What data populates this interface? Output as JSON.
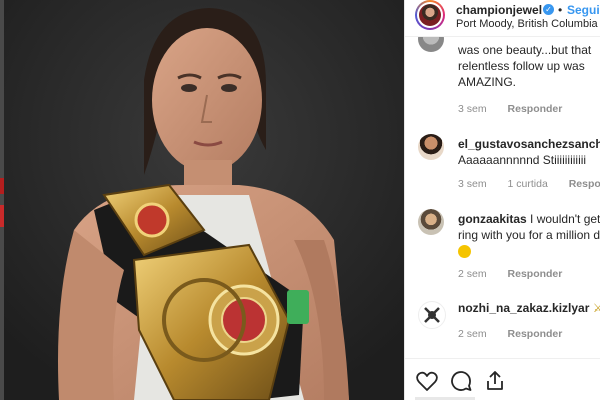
{
  "header": {
    "username": "championjewel",
    "separator": "•",
    "follow_label": "Seguir",
    "location": "Port Moody, British Columbia",
    "icons": {
      "verified": "verified-badge-icon",
      "avatar": "profile-avatar"
    }
  },
  "comments": [
    {
      "username": "",
      "text_lines": [
        "was one beauty...but that",
        "relentless follow up was",
        "AMAZING."
      ],
      "time": "3 sem",
      "likes": "",
      "reply": "Responder"
    },
    {
      "username": "el_gustavosanchezsanchez",
      "text_lines": [
        "Aaaaaannnnnd Stiiiiiiiiiiii"
      ],
      "time": "3 sem",
      "likes": "1 curtida",
      "reply": "Responder"
    },
    {
      "username": "gonzaakitas",
      "text_lines": [
        "I wouldn't get in the",
        "ring with you for a million d"
      ],
      "time": "2 sem",
      "likes": "",
      "reply": "Responder"
    },
    {
      "username": "nozhi_na_zakaz.kizlyar",
      "text_lines": [
        ""
      ],
      "time": "2 sem",
      "likes": "",
      "reply": "Responder"
    }
  ],
  "actions": {
    "like": "heart-icon",
    "comment": "comment-icon",
    "share": "share-icon"
  },
  "colors": {
    "accent": "#3897f0",
    "text": "#262626",
    "muted": "#8e8e8e",
    "photo_bg": "#2b2b2b"
  }
}
